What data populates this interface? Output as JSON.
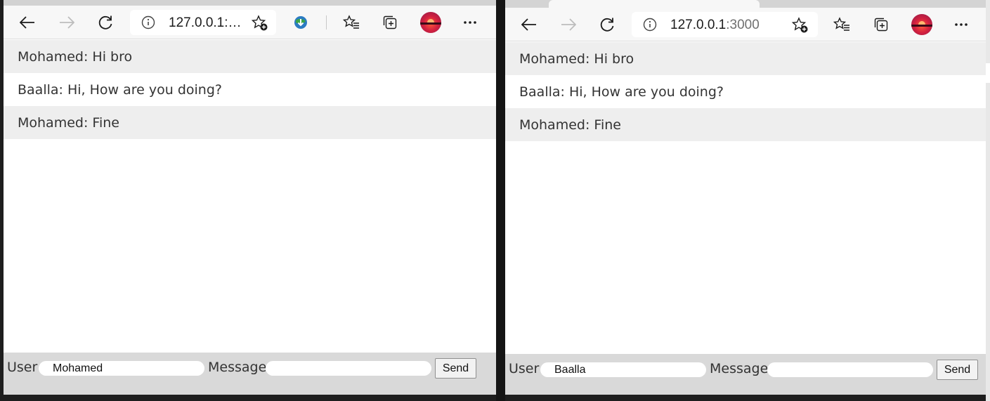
{
  "windows": [
    {
      "address": {
        "host": "127.0.0.1:…",
        "port": ""
      },
      "messages": [
        {
          "text": "Mohamed: Hi bro"
        },
        {
          "text": "Baalla: Hi, How are you doing?"
        },
        {
          "text": "Mohamed: Fine"
        }
      ],
      "form": {
        "user_label": "User",
        "user_value": "Mohamed",
        "message_label": "Message",
        "message_value": "",
        "send_label": "Send"
      }
    },
    {
      "address": {
        "host": "127.0.0.1",
        "port": ":3000"
      },
      "messages": [
        {
          "text": "Mohamed: Hi bro"
        },
        {
          "text": "Baalla: Hi, How are you doing?"
        },
        {
          "text": "Mohamed: Fine"
        }
      ],
      "form": {
        "user_label": "User",
        "user_value": "Baalla",
        "message_label": "Message",
        "message_value": "",
        "send_label": "Send"
      }
    }
  ],
  "icons": [
    "back-icon",
    "forward-icon",
    "refresh-icon",
    "info-icon",
    "add-favorite-icon",
    "extension-icon",
    "favorites-icon",
    "collections-icon",
    "profile-avatar",
    "more-icon"
  ],
  "colors": {
    "toolbar": "#f7f7f7",
    "message_odd": "#eeeeee",
    "message_even": "#ffffff",
    "form_bar": "#d9d9d9",
    "text": "#333333"
  }
}
